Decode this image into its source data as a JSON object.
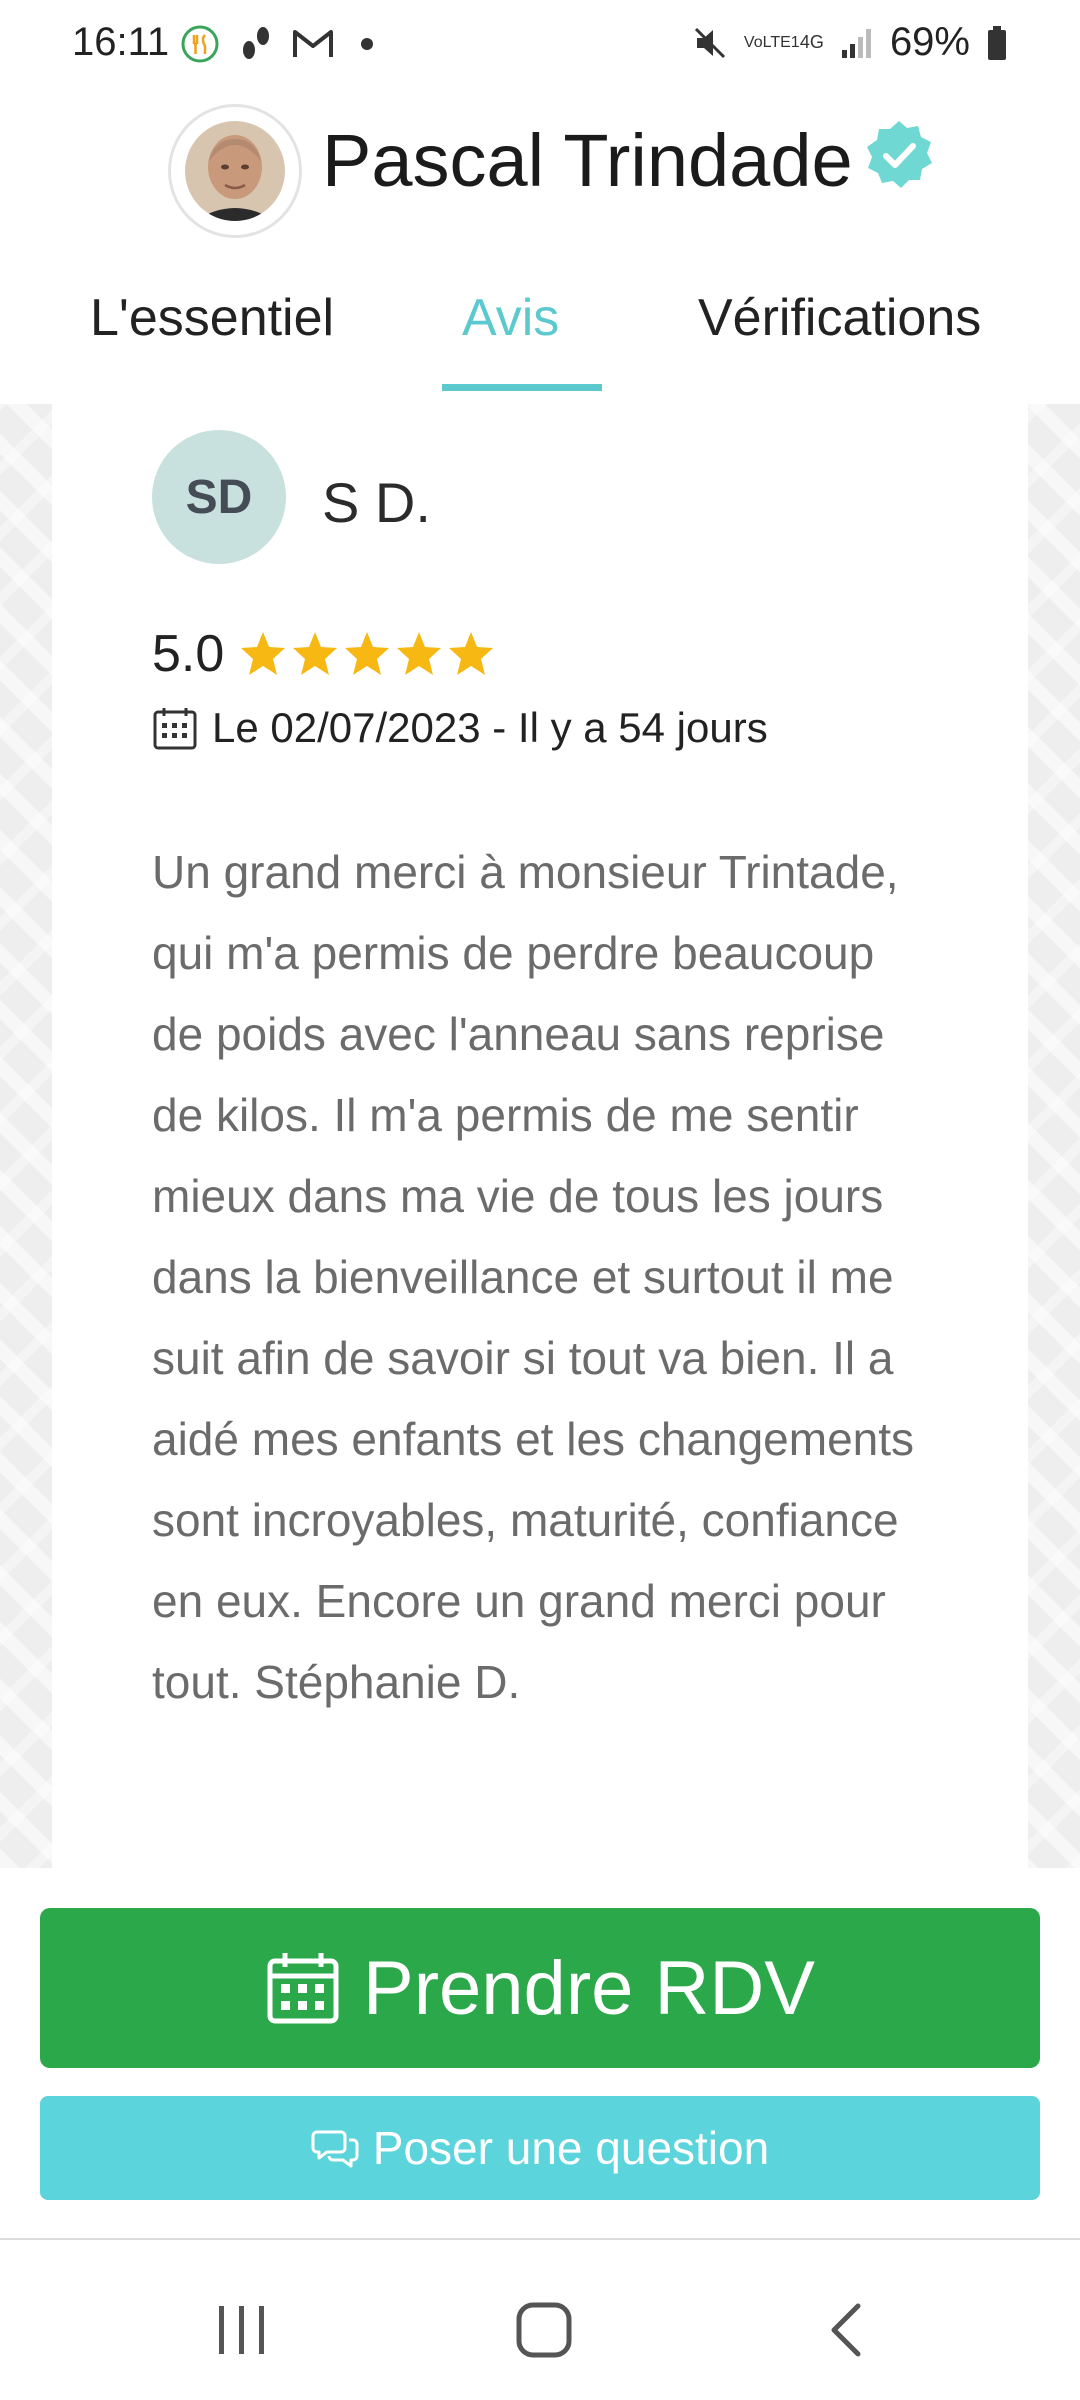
{
  "status_bar": {
    "time": "16:11",
    "battery_percent": "69%",
    "network": "4G",
    "volte_label": "VoLTE1",
    "icons": [
      "restaurant-icon",
      "footsteps-icon",
      "gmail-icon",
      "dot-icon",
      "mute-icon",
      "signal-icon",
      "battery-icon"
    ]
  },
  "header": {
    "doctor_name": "Pascal Trindade",
    "verified_icon": "verified-badge-icon",
    "accent_color": "#5cc9cf"
  },
  "tabs": [
    {
      "label": "L'essentiel",
      "active": false
    },
    {
      "label": "Avis",
      "active": true
    },
    {
      "label": "Vérifications",
      "active": false
    }
  ],
  "review": {
    "initials": "SD",
    "reviewer_name": "S D.",
    "rating": "5.0",
    "stars": 5,
    "date_text": "Le 02/07/2023 - Il y a 54 jours",
    "text": "Un grand merci à monsieur Trintade, qui m'a permis de perdre beaucoup de poids avec l'anneau sans reprise de kilos. Il m'a permis de me sentir mieux dans ma vie de tous les jours dans la bienveillance et surtout il me suit afin de savoir si tout va bien. Il a aidé mes enfants et les changements sont incroyables, maturité, confiance en eux. Encore un grand merci pour tout. Stéphanie D."
  },
  "actions": {
    "rdv_label": "Prendre RDV",
    "rdv_color": "#2ba84a",
    "question_label": "Poser une question",
    "question_color": "#5bd4dc"
  },
  "nav_bar": {
    "buttons": [
      "recents-icon",
      "home-icon",
      "back-icon"
    ]
  }
}
